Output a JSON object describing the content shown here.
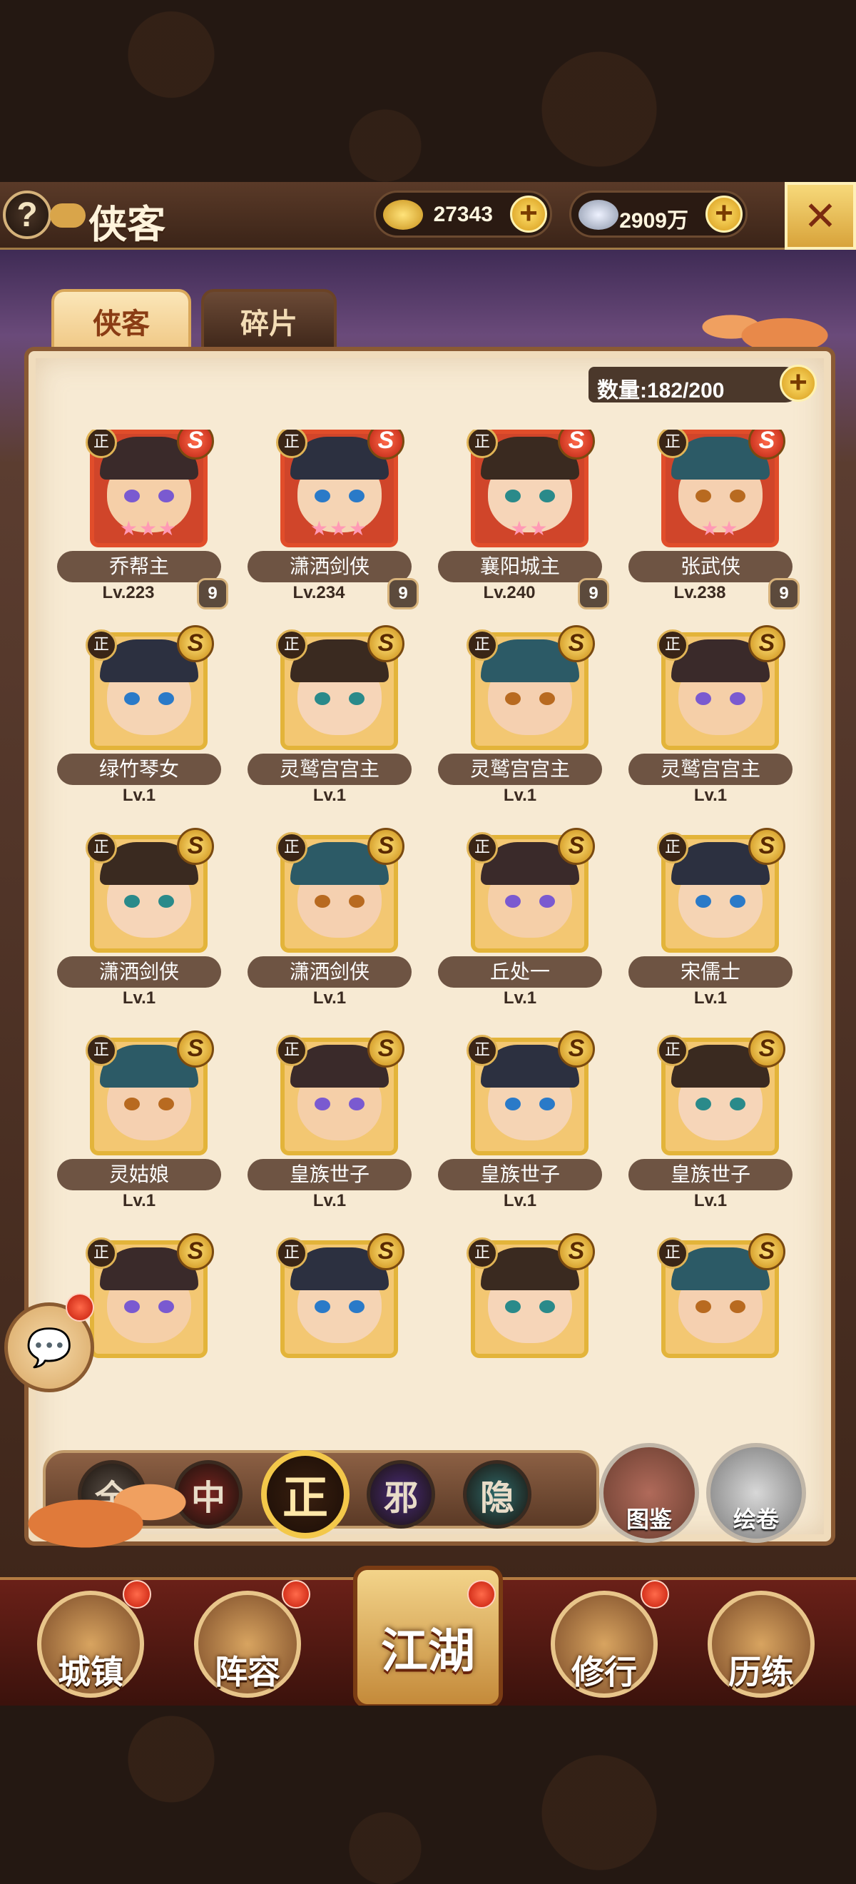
{
  "header": {
    "title": "侠客",
    "help_icon": "question-mark",
    "gold": "27343",
    "silver": "2909万",
    "close_icon": "crossed-swords"
  },
  "tabs": [
    {
      "label": "侠客",
      "active": true
    },
    {
      "label": "碎片",
      "active": false
    }
  ],
  "capacity": {
    "label": "数量:182/200"
  },
  "heroes": [
    {
      "name": "乔帮主",
      "level": "Lv.223",
      "rank": "9",
      "stars": "★★★",
      "grade": "S",
      "faction": "正",
      "rarity": "red"
    },
    {
      "name": "潇洒剑侠",
      "level": "Lv.234",
      "rank": "9",
      "stars": "★★★",
      "grade": "S",
      "faction": "正",
      "rarity": "red"
    },
    {
      "name": "襄阳城主",
      "level": "Lv.240",
      "rank": "9",
      "stars": "★★",
      "grade": "S",
      "faction": "正",
      "rarity": "red"
    },
    {
      "name": "张武侠",
      "level": "Lv.238",
      "rank": "9",
      "stars": "★★",
      "grade": "S",
      "faction": "正",
      "rarity": "red"
    },
    {
      "name": "绿竹琴女",
      "level": "Lv.1",
      "grade": "S",
      "faction": "正",
      "rarity": "gold"
    },
    {
      "name": "灵鹫宫宫主",
      "level": "Lv.1",
      "grade": "S",
      "faction": "正",
      "rarity": "gold"
    },
    {
      "name": "灵鹫宫宫主",
      "level": "Lv.1",
      "grade": "S",
      "faction": "正",
      "rarity": "gold"
    },
    {
      "name": "灵鹫宫宫主",
      "level": "Lv.1",
      "grade": "S",
      "faction": "正",
      "rarity": "gold"
    },
    {
      "name": "潇洒剑侠",
      "level": "Lv.1",
      "grade": "S",
      "faction": "正",
      "rarity": "gold"
    },
    {
      "name": "潇洒剑侠",
      "level": "Lv.1",
      "grade": "S",
      "faction": "正",
      "rarity": "gold"
    },
    {
      "name": "丘处一",
      "level": "Lv.1",
      "grade": "S",
      "faction": "正",
      "rarity": "gold"
    },
    {
      "name": "宋儒士",
      "level": "Lv.1",
      "grade": "S",
      "faction": "正",
      "rarity": "gold"
    },
    {
      "name": "灵姑娘",
      "level": "Lv.1",
      "grade": "S",
      "faction": "正",
      "rarity": "gold"
    },
    {
      "name": "皇族世子",
      "level": "Lv.1",
      "grade": "S",
      "faction": "正",
      "rarity": "gold"
    },
    {
      "name": "皇族世子",
      "level": "Lv.1",
      "grade": "S",
      "faction": "正",
      "rarity": "gold"
    },
    {
      "name": "皇族世子",
      "level": "Lv.1",
      "grade": "S",
      "faction": "正",
      "rarity": "gold"
    },
    {
      "name": "",
      "level": "",
      "grade": "S",
      "faction": "正",
      "rarity": "gold"
    },
    {
      "name": "",
      "level": "",
      "grade": "S",
      "faction": "正",
      "rarity": "gold"
    },
    {
      "name": "",
      "level": "",
      "grade": "S",
      "faction": "正",
      "rarity": "gold"
    },
    {
      "name": "",
      "level": "",
      "grade": "S",
      "faction": "正",
      "rarity": "gold"
    }
  ],
  "filters": [
    {
      "label": "全",
      "color": "#5a5048"
    },
    {
      "label": "中",
      "color": "#7a2420"
    },
    {
      "label": "正",
      "color": "#2a1a10",
      "active": true
    },
    {
      "label": "邪",
      "color": "#4a2c7a"
    },
    {
      "label": "隐",
      "color": "#2f6a6a"
    }
  ],
  "side_buttons": {
    "atlas": "图鉴",
    "scroll": "绘卷"
  },
  "nav": {
    "town": "城镇",
    "lineup": "阵容",
    "world": "江湖",
    "training": "修行",
    "trial": "历练"
  },
  "colors": {
    "accent_gold": "#e3b43a",
    "rarity_red": "#e14d2a",
    "panel_bg": "#f7ead3"
  }
}
